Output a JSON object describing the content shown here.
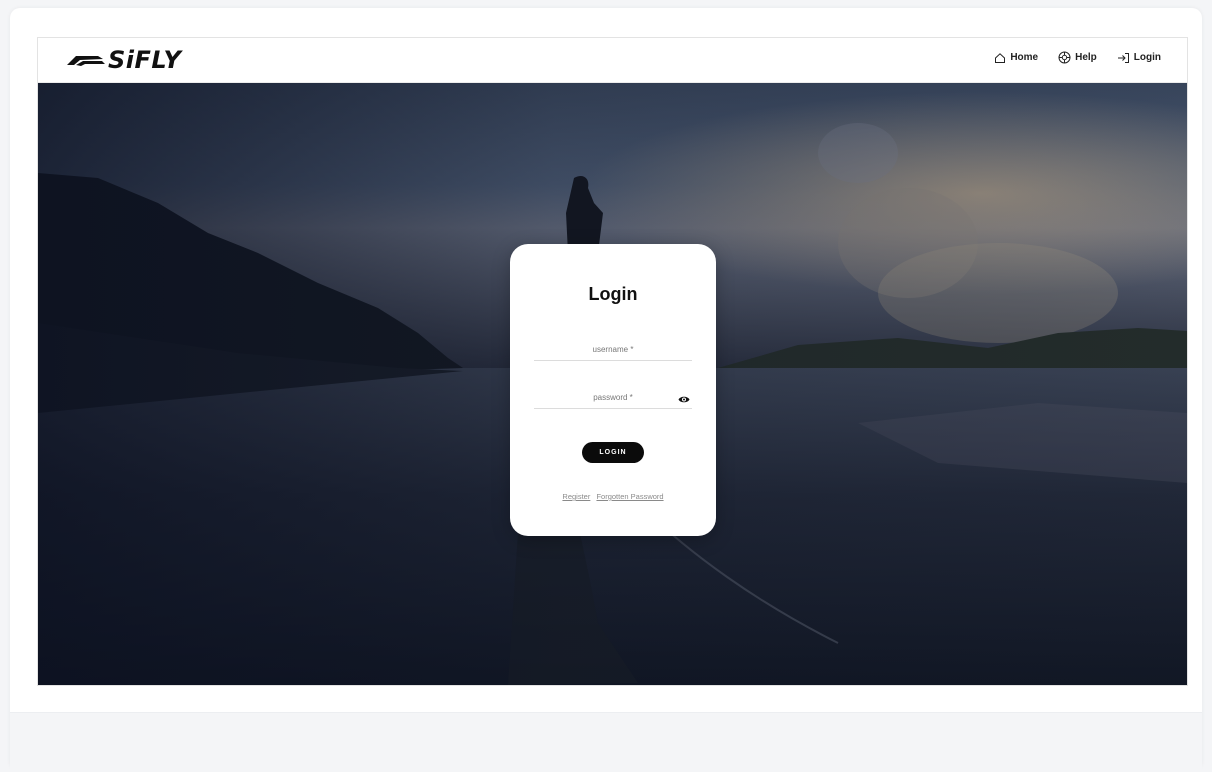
{
  "header": {
    "logo_text": "SiFLY",
    "nav": [
      {
        "label": "Home",
        "icon": "home-icon"
      },
      {
        "label": "Help",
        "icon": "help-icon"
      },
      {
        "label": "Login",
        "icon": "login-icon"
      }
    ]
  },
  "login_card": {
    "title": "Login",
    "username_placeholder": "username *",
    "password_placeholder": "password *",
    "submit_label": "LOGIN",
    "register_label": "Register",
    "forgot_label": "Forgotten Password"
  },
  "colors": {
    "accent": "#0b0b0b",
    "card": "#ffffff"
  }
}
